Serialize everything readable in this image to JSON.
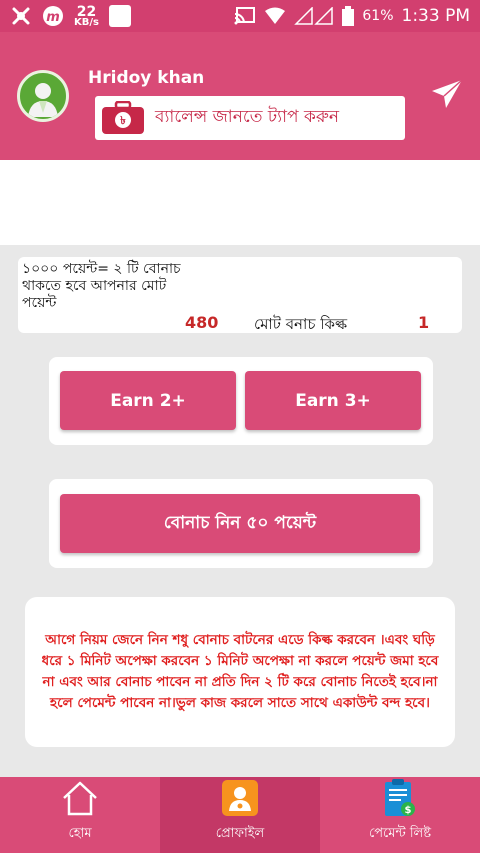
{
  "status_bar": {
    "network_speed_value": "22",
    "network_speed_unit": "KB/s",
    "battery": "61%",
    "time": "1:33 PM"
  },
  "header": {
    "username": "Hridoy khan",
    "balance_button_label": "ব্যালেন্স জানতে ট্যাপ করুন",
    "wallet_symbol": "৳"
  },
  "info": {
    "description": "১০০০ পয়েন্ট= ২ টি বোনাচ থাকতে হবে আপনার মোট পয়েন্ট",
    "points_value": "480",
    "bonus_clicks_label": "মোট বনাচ কিল্ক",
    "bonus_clicks_value": "1"
  },
  "earn": {
    "earn2_label": "Earn 2+",
    "earn3_label": "Earn 3+"
  },
  "bonus": {
    "button_label": "বোনাচ নিন ৫০ পয়েন্ট"
  },
  "rules": {
    "text": "আগে নিয়ম জেনে নিন শধু বোনাচ বাটনের এডে কিল্ক করবেন ।এবং ঘড়ি ধরে ১ মিনিট অপেক্ষা করবেন ১ মিনিট অপেক্ষা না করলে পয়েন্ট জমা হবে না এবং আর বোনাচ পাবেন না প্রতি দিন ২ টি করে বোনাচ নিতেই হবে।না হলে পেমেন্ট পাবেন না।ভুল কাজ করলে সাতে সাথে একাউন্ট বন্দ হবে।"
  },
  "bottom_nav": {
    "items": [
      {
        "label": "হোম",
        "icon": "home-icon"
      },
      {
        "label": "প্রোফাইল",
        "icon": "profile-icon"
      },
      {
        "label": "পেমেন্ট লিষ্ট",
        "icon": "payment-list-icon"
      }
    ]
  },
  "colors": {
    "primary": "#d94b77",
    "status_bar": "#d23f6f",
    "accent_red": "#c62828"
  }
}
